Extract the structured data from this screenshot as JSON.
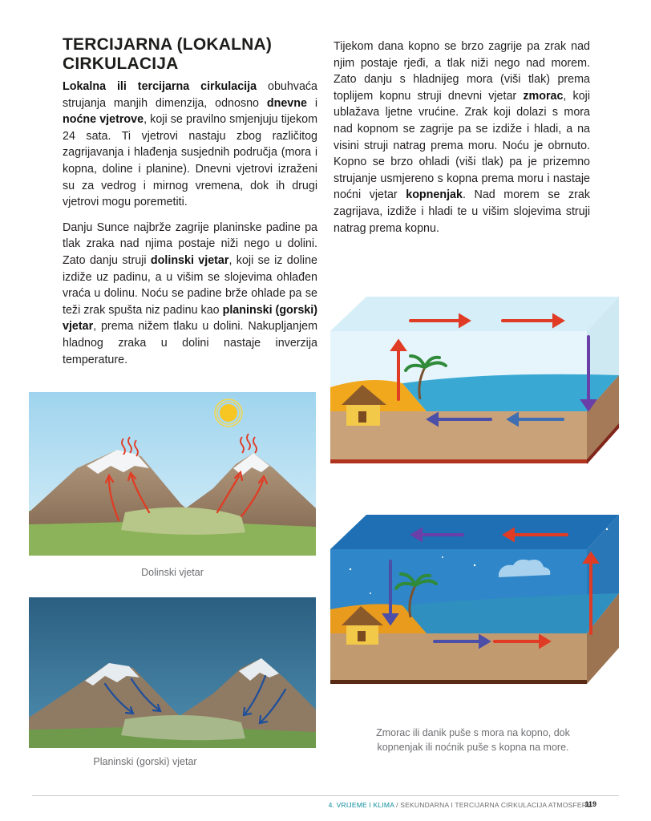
{
  "title_line1": "TERCIJARNA (LOKALNA)",
  "title_line2": "CIRKULACIJA",
  "paragraph1": [
    {
      "t": "Lokalna ili tercijarna cirkulacija",
      "b": true
    },
    {
      "t": " obuhvaća strujanja manjih dimenzija, odnosno ",
      "b": false
    },
    {
      "t": "dnevne",
      "b": true
    },
    {
      "t": " i ",
      "b": false
    },
    {
      "t": "noćne vjetrove",
      "b": true
    },
    {
      "t": ", koji se pravilno smjenjuju tijekom 24 sata. Ti vjetrovi nastaju zbog različitog zagrijavanja i hlađenja susjednih područja (mora i kopna, doline i planine). Dnevni vjetrovi izraženi su za vedrog i mirnog vremena, dok ih drugi vjetrovi mogu poremetiti.",
      "b": false
    }
  ],
  "paragraph2": [
    {
      "t": "Danju Sunce najbrže zagrije planinske padine pa tlak zraka nad njima postaje niži nego u dolini. Zato danju struji ",
      "b": false
    },
    {
      "t": "dolinski vjetar",
      "b": true
    },
    {
      "t": ", koji se iz doline izdiže uz padinu, a u višim se slojevima ohlađen vraća u dolinu. Noću se padine brže ohlade pa se teži zrak spušta niz padinu kao ",
      "b": false
    },
    {
      "t": "planinski (gorski) vjetar",
      "b": true
    },
    {
      "t": ", prema nižem tlaku u dolini. Nakupljanjem hladnog zraka u dolini nastaje inverzija temperature.",
      "b": false
    }
  ],
  "paragraph3": [
    {
      "t": "Tijekom dana kopno se brzo zagrije pa zrak nad njim postaje rjeđi, a tlak niži nego nad morem. Zato danju s hladnijeg mora (viši tlak) prema toplijem kopnu struji dnevni vjetar ",
      "b": false
    },
    {
      "t": "zmorac",
      "b": true
    },
    {
      "t": ", koji ublažava ljetne vrućine. Zrak koji dolazi s mora nad kopnom se zagrije pa se izdiže i hladi, a na visini struji natrag prema moru. Noću je obrnuto. Kopno se brzo ohladi (viši tlak) pa je prizemno strujanje usmjereno s kopna prema moru i nastaje noćni vjetar ",
      "b": false
    },
    {
      "t": "kopnenjak",
      "b": true
    },
    {
      "t": ". Nad morem se zrak zagrijava, izdiže i hladi te u višim slojevima struji natrag prema kopnu.",
      "b": false
    }
  ],
  "captions": {
    "valley": "Dolinski vjetar",
    "mountain": "Planinski (gorski) vjetar",
    "sea_line1": "Zmorac ili danik puše s mora na kopno, dok",
    "sea_line2": "kopnenjak ili noćnik puše s kopna na more."
  },
  "footer": {
    "chapter": "4. VRIJEME I KLIMA",
    "separator": " / ",
    "section": "SEKUNDARNA I TERCIJARNA CIRKULACIJA ATMOSFERE",
    "page": "119"
  },
  "colors": {
    "accent": "#0f8c9c",
    "warm_arrow": "#e03b24",
    "cool_arrow": "#4b4fa8",
    "night_sky": "#2e6e96"
  }
}
